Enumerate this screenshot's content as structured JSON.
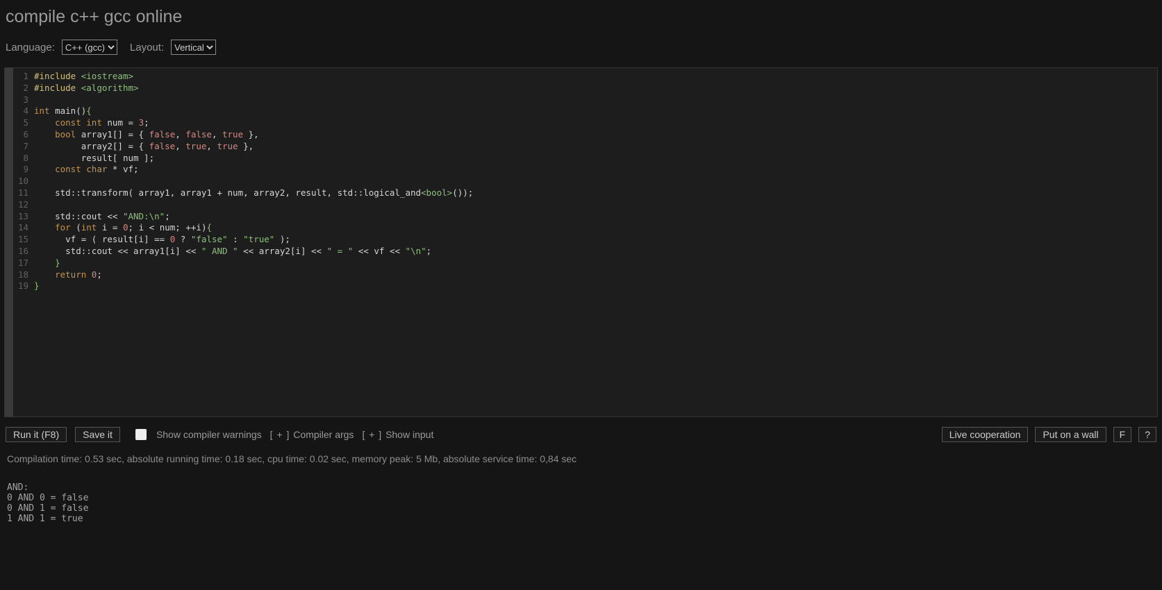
{
  "title": "compile c++ gcc online",
  "options": {
    "language_label": "Language:",
    "language_value": "C++ (gcc)",
    "layout_label": "Layout:",
    "layout_value": "Vertical"
  },
  "line_count": 19,
  "code_tokens": [
    [
      [
        "pp",
        "#include"
      ],
      [
        "pun",
        " "
      ],
      [
        "str",
        "<iostream>"
      ]
    ],
    [
      [
        "pp",
        "#include"
      ],
      [
        "pun",
        " "
      ],
      [
        "str",
        "<algorithm>"
      ]
    ],
    [],
    [
      [
        "kw",
        "int"
      ],
      [
        "pun",
        " "
      ],
      [
        "id",
        "main"
      ],
      [
        "pun",
        "()"
      ],
      [
        "br",
        "{"
      ]
    ],
    [
      [
        "pun",
        "    "
      ],
      [
        "kw",
        "const"
      ],
      [
        "pun",
        " "
      ],
      [
        "kw",
        "int"
      ],
      [
        "pun",
        " "
      ],
      [
        "id",
        "num"
      ],
      [
        "pun",
        " "
      ],
      [
        "op",
        "="
      ],
      [
        "pun",
        " "
      ],
      [
        "num",
        "3"
      ],
      [
        "pun",
        ";"
      ]
    ],
    [
      [
        "pun",
        "    "
      ],
      [
        "kw",
        "bool"
      ],
      [
        "pun",
        " "
      ],
      [
        "id",
        "array1"
      ],
      [
        "pun",
        "[] "
      ],
      [
        "op",
        "="
      ],
      [
        "pun",
        " { "
      ],
      [
        "lit",
        "false"
      ],
      [
        "pun",
        ", "
      ],
      [
        "lit",
        "false"
      ],
      [
        "pun",
        ", "
      ],
      [
        "lit",
        "true"
      ],
      [
        "pun",
        " },"
      ]
    ],
    [
      [
        "pun",
        "         "
      ],
      [
        "id",
        "array2"
      ],
      [
        "pun",
        "[] "
      ],
      [
        "op",
        "="
      ],
      [
        "pun",
        " { "
      ],
      [
        "lit",
        "false"
      ],
      [
        "pun",
        ", "
      ],
      [
        "lit",
        "true"
      ],
      [
        "pun",
        ", "
      ],
      [
        "lit",
        "true"
      ],
      [
        "pun",
        " },"
      ]
    ],
    [
      [
        "pun",
        "         "
      ],
      [
        "id",
        "result"
      ],
      [
        "pun",
        "[ "
      ],
      [
        "id",
        "num"
      ],
      [
        "pun",
        " ];"
      ]
    ],
    [
      [
        "pun",
        "    "
      ],
      [
        "kw",
        "const"
      ],
      [
        "pun",
        " "
      ],
      [
        "kw",
        "char"
      ],
      [
        "pun",
        " "
      ],
      [
        "op",
        "*"
      ],
      [
        "pun",
        " "
      ],
      [
        "id",
        "vf"
      ],
      [
        "pun",
        ";"
      ]
    ],
    [],
    [
      [
        "pun",
        "    "
      ],
      [
        "id",
        "std"
      ],
      [
        "op",
        "::"
      ],
      [
        "id",
        "transform"
      ],
      [
        "pun",
        "( "
      ],
      [
        "id",
        "array1"
      ],
      [
        "pun",
        ", "
      ],
      [
        "id",
        "array1"
      ],
      [
        "pun",
        " "
      ],
      [
        "op",
        "+"
      ],
      [
        "pun",
        " "
      ],
      [
        "id",
        "num"
      ],
      [
        "pun",
        ", "
      ],
      [
        "id",
        "array2"
      ],
      [
        "pun",
        ", "
      ],
      [
        "id",
        "result"
      ],
      [
        "pun",
        ", "
      ],
      [
        "id",
        "std"
      ],
      [
        "op",
        "::"
      ],
      [
        "id",
        "logical_and"
      ],
      [
        "tmpl",
        "<bool>"
      ],
      [
        "pun",
        "());"
      ]
    ],
    [],
    [
      [
        "pun",
        "    "
      ],
      [
        "id",
        "std"
      ],
      [
        "op",
        "::"
      ],
      [
        "id",
        "cout"
      ],
      [
        "pun",
        " "
      ],
      [
        "op",
        "<<"
      ],
      [
        "pun",
        " "
      ],
      [
        "str",
        "\"AND:\\n\""
      ],
      [
        "pun",
        ";"
      ]
    ],
    [
      [
        "pun",
        "    "
      ],
      [
        "kw",
        "for"
      ],
      [
        "pun",
        " ("
      ],
      [
        "kw",
        "int"
      ],
      [
        "pun",
        " "
      ],
      [
        "id",
        "i"
      ],
      [
        "pun",
        " "
      ],
      [
        "op",
        "="
      ],
      [
        "pun",
        " "
      ],
      [
        "num",
        "0"
      ],
      [
        "pun",
        "; "
      ],
      [
        "id",
        "i"
      ],
      [
        "pun",
        " "
      ],
      [
        "op",
        "<"
      ],
      [
        "pun",
        " "
      ],
      [
        "id",
        "num"
      ],
      [
        "pun",
        "; "
      ],
      [
        "op",
        "++"
      ],
      [
        "id",
        "i"
      ],
      [
        "pun",
        ")"
      ],
      [
        "br",
        "{"
      ]
    ],
    [
      [
        "pun",
        "      "
      ],
      [
        "id",
        "vf"
      ],
      [
        "pun",
        " "
      ],
      [
        "op",
        "="
      ],
      [
        "pun",
        " ( "
      ],
      [
        "id",
        "result"
      ],
      [
        "pun",
        "["
      ],
      [
        "id",
        "i"
      ],
      [
        "pun",
        "] "
      ],
      [
        "op",
        "=="
      ],
      [
        "pun",
        " "
      ],
      [
        "num",
        "0"
      ],
      [
        "pun",
        " "
      ],
      [
        "op",
        "?"
      ],
      [
        "pun",
        " "
      ],
      [
        "str",
        "\"false\""
      ],
      [
        "pun",
        " "
      ],
      [
        "op",
        ":"
      ],
      [
        "pun",
        " "
      ],
      [
        "str",
        "\"true\""
      ],
      [
        "pun",
        " );"
      ]
    ],
    [
      [
        "pun",
        "      "
      ],
      [
        "id",
        "std"
      ],
      [
        "op",
        "::"
      ],
      [
        "id",
        "cout"
      ],
      [
        "pun",
        " "
      ],
      [
        "op",
        "<<"
      ],
      [
        "pun",
        " "
      ],
      [
        "id",
        "array1"
      ],
      [
        "pun",
        "["
      ],
      [
        "id",
        "i"
      ],
      [
        "pun",
        "] "
      ],
      [
        "op",
        "<<"
      ],
      [
        "pun",
        " "
      ],
      [
        "str",
        "\" AND \""
      ],
      [
        "pun",
        " "
      ],
      [
        "op",
        "<<"
      ],
      [
        "pun",
        " "
      ],
      [
        "id",
        "array2"
      ],
      [
        "pun",
        "["
      ],
      [
        "id",
        "i"
      ],
      [
        "pun",
        "] "
      ],
      [
        "op",
        "<<"
      ],
      [
        "pun",
        " "
      ],
      [
        "str",
        "\" = \""
      ],
      [
        "pun",
        " "
      ],
      [
        "op",
        "<<"
      ],
      [
        "pun",
        " "
      ],
      [
        "id",
        "vf"
      ],
      [
        "pun",
        " "
      ],
      [
        "op",
        "<<"
      ],
      [
        "pun",
        " "
      ],
      [
        "str",
        "\"\\n\""
      ],
      [
        "pun",
        ";"
      ]
    ],
    [
      [
        "pun",
        "    "
      ],
      [
        "br",
        "}"
      ]
    ],
    [
      [
        "pun",
        "    "
      ],
      [
        "kw",
        "return"
      ],
      [
        "pun",
        " "
      ],
      [
        "num",
        "0"
      ],
      [
        "pun",
        ";"
      ]
    ],
    [
      [
        "br",
        "}"
      ]
    ]
  ],
  "toolbar": {
    "run": "Run it (F8)",
    "save": "Save it",
    "show_warnings": "Show compiler warnings",
    "compiler_args_prefix": "[ + ] ",
    "compiler_args": "Compiler args",
    "show_input_prefix": "[ + ] ",
    "show_input": "Show input",
    "live_coop": "Live cooperation",
    "wall": "Put on a wall",
    "f": "F",
    "help": "?"
  },
  "stats": "Compilation time: 0.53 sec, absolute running time: 0.18 sec, cpu time: 0.02 sec, memory peak: 5 Mb, absolute service time: 0,84 sec",
  "output": "AND:\n0 AND 0 = false\n0 AND 1 = false\n1 AND 1 = true"
}
